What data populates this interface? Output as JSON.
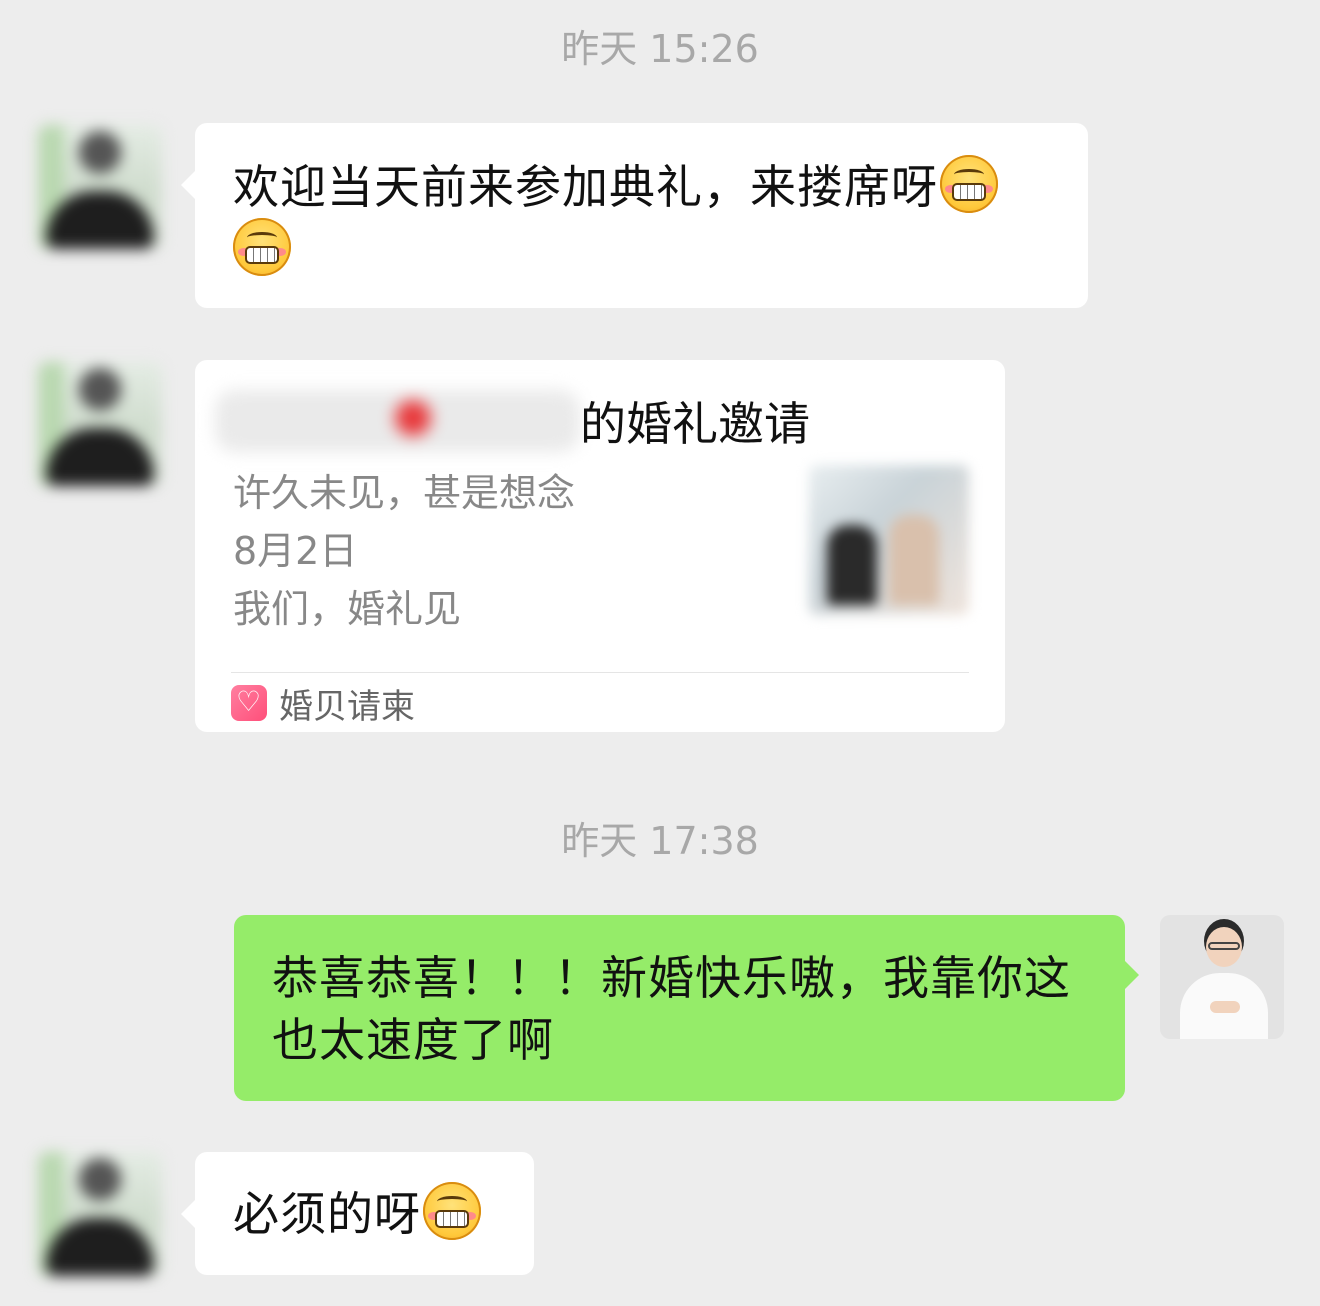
{
  "timestamps": [
    "昨天 15:26",
    "昨天 17:38"
  ],
  "messages": [
    {
      "sender": "friend",
      "text": "欢迎当天前来参加典礼，来搂席呀",
      "emoji": "grinning-face-icon",
      "emoji_count": 2
    },
    {
      "sender": "friend",
      "type": "invitation-card",
      "title": "的婚礼邀请",
      "desc": [
        "许久未见，甚是想念",
        "8月2日",
        "我们，婚礼见"
      ],
      "source": "婚贝请柬"
    },
    {
      "sender": "me",
      "text": "恭喜恭喜！！！新婚快乐嗷，我靠你这也太速度了啊"
    },
    {
      "sender": "friend",
      "text": "必须的呀",
      "emoji": "grinning-face-icon",
      "emoji_count": 1
    }
  ],
  "colors": {
    "background": "#ededed",
    "incoming_bubble": "#ffffff",
    "outgoing_bubble": "#95ec69",
    "timestamp": "#a8a8a8"
  }
}
